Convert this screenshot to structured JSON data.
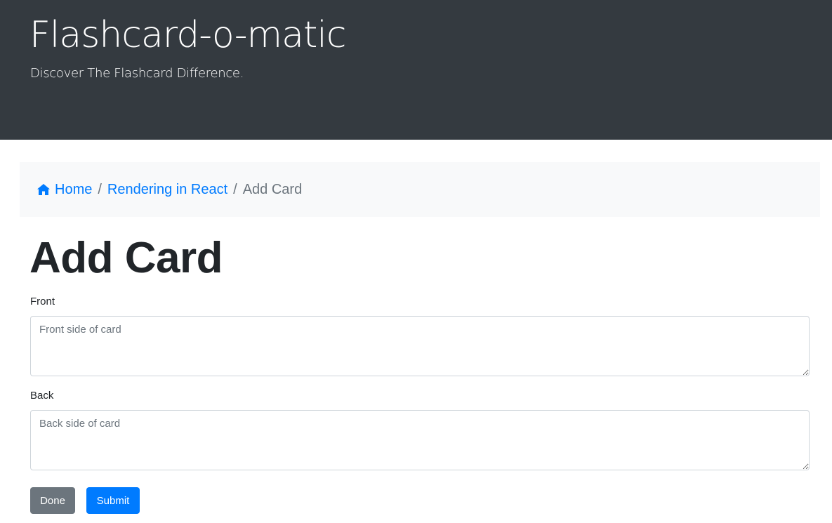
{
  "header": {
    "title": "Flashcard-o-matic",
    "tagline": "Discover The Flashcard Difference."
  },
  "breadcrumb": {
    "home_icon": "home-icon",
    "home_label": "Home",
    "deck_label": "Rendering in React",
    "current_label": "Add Card",
    "separator": "/"
  },
  "page": {
    "title": "Add Card"
  },
  "form": {
    "front_label": "Front",
    "front_placeholder": "Front side of card",
    "front_value": "",
    "back_label": "Back",
    "back_placeholder": "Back side of card",
    "back_value": "",
    "done_label": "Done",
    "submit_label": "Submit"
  },
  "colors": {
    "header_bg": "#343a40",
    "link": "#007bff",
    "secondary_button": "#6c757d",
    "primary_button": "#007bff",
    "breadcrumb_bg": "#f8f9fa"
  }
}
